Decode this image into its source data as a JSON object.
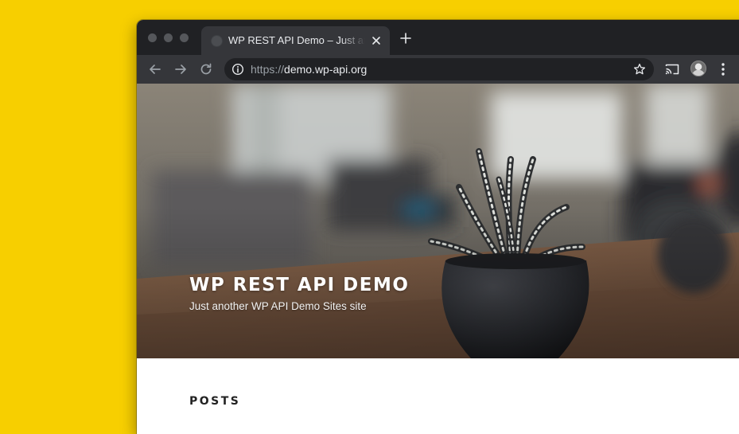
{
  "browser": {
    "tab_title": "WP REST API Demo – Just another WP API Demo Sites site",
    "url_scheme": "https://",
    "url_host": "demo.wp-api.org"
  },
  "site": {
    "title": "WP REST API DEMO",
    "tagline": "Just another WP API Demo Sites site"
  },
  "content": {
    "section_heading": "POSTS"
  },
  "colors": {
    "background": "#f7cf00",
    "chrome_dark": "#202124",
    "chrome_toolbar": "#35363a"
  },
  "icons": [
    "globe-icon",
    "close-icon",
    "plus-icon",
    "back-arrow-icon",
    "forward-arrow-icon",
    "reload-icon",
    "info-icon",
    "star-icon",
    "cast-icon",
    "avatar",
    "kebab-menu-icon"
  ]
}
